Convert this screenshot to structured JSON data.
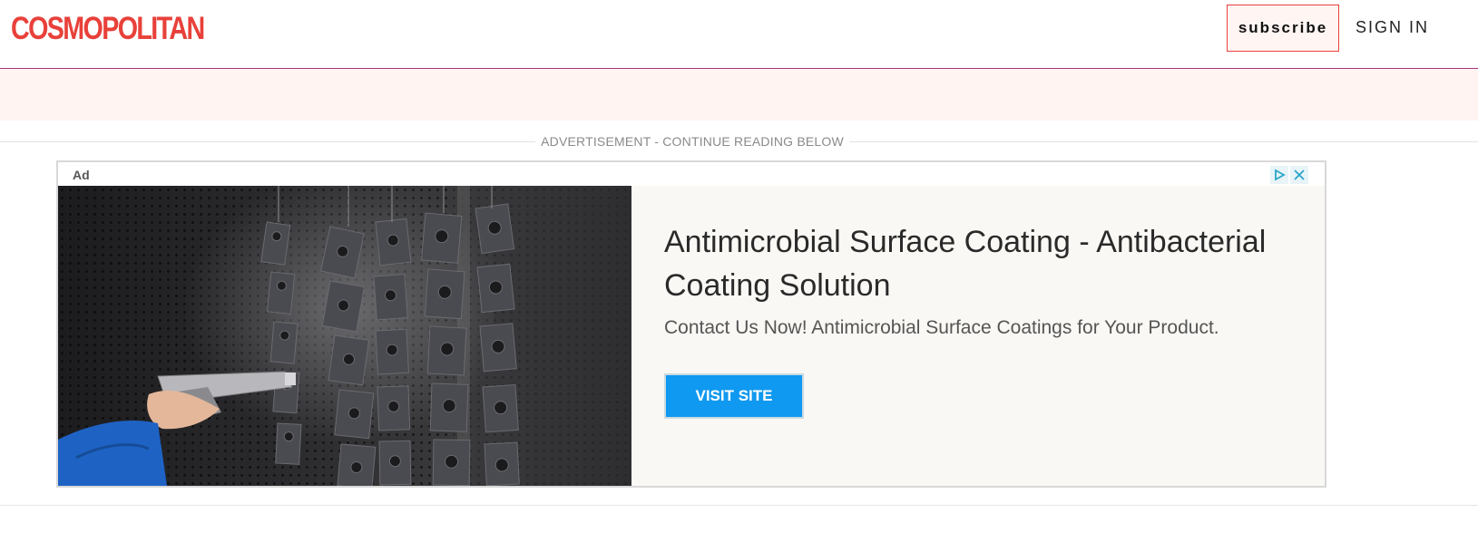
{
  "header": {
    "logo": "COSMOPOLITAN",
    "subscribe_label": "subscribe",
    "signin_label": "SIGN IN"
  },
  "ad_notice": "ADVERTISEMENT - CONTINUE READING BELOW",
  "ad": {
    "tag": "Ad",
    "title": "Antimicrobial Surface Coating - Antibacterial Coating Solution",
    "description": "Contact Us Now! Antimicrobial Surface Coatings for Your Product.",
    "cta_label": "VISIT SITE"
  },
  "icons": {
    "adchoices": "play-triangle-icon",
    "close": "close-icon"
  },
  "colors": {
    "brand": "#e8413a",
    "header_rule": "#a8337a",
    "pink_band": "#fff4f2",
    "cta": "#1099f0"
  }
}
